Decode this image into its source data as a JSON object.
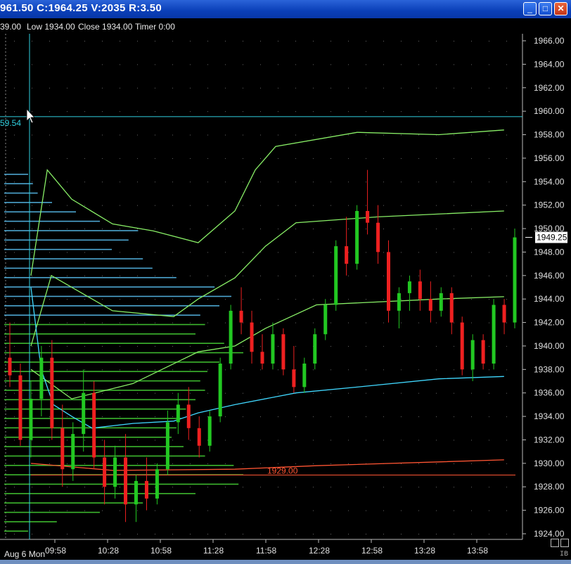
{
  "window": {
    "title": "961.50 C:1964.25 V:2035 R:3.50",
    "minimize_label": "_",
    "maximize_label": "□",
    "close_label": "✕"
  },
  "infobar": {
    "high": "39.00",
    "low": "Low 1934.00",
    "close": "Close 1934.00",
    "timer": "Timer 0:00"
  },
  "colors": {
    "up_candle": "#22c822",
    "down_candle": "#ee2020",
    "vwap": "#88ee66",
    "band_upper": "#88ee66",
    "band_lower": "#40d8ff",
    "profile_upper": "#55b8e8",
    "profile_lower": "#44cc33",
    "level_line": "#ff5533",
    "crosshair": "#30d0e0"
  },
  "chart_data": {
    "type": "candlestick",
    "y_ticks": [
      "1966.00",
      "1964.00",
      "1962.00",
      "1960.00",
      "1958.00",
      "1956.00",
      "1954.00",
      "1952.00",
      "1950.00",
      "1948.00",
      "1946.00",
      "1944.00",
      "1942.00",
      "1940.00",
      "1938.00",
      "1936.00",
      "1934.00",
      "1932.00",
      "1930.00",
      "1928.00",
      "1926.00",
      "1924.00"
    ],
    "x_ticks": [
      "09:58",
      "10:28",
      "10:58",
      "11:28",
      "11:58",
      "12:28",
      "12:58",
      "13:28",
      "13:58"
    ],
    "ylim": [
      1924,
      1966
    ],
    "date_label": "Aug 6 Mon",
    "source_label": "IB",
    "last_price": "1949.25",
    "crosshair_price": "59.54",
    "crosshair_price_value": 1959.54,
    "level_price": "1929.00",
    "level_value": 1929.0,
    "vwap_segment": [
      {
        "t": 0,
        "p": 1945.0
      },
      {
        "t": 5,
        "p": 1938.0
      },
      {
        "t": 11,
        "p": 1935.0
      },
      {
        "t": 20,
        "p": 1934.0
      },
      {
        "t": 30,
        "p": 1933.0
      },
      {
        "t": 50,
        "p": 1933.4
      },
      {
        "t": 70,
        "p": 1933.6
      },
      {
        "t": 82,
        "p": 1934.3
      },
      {
        "t": 100,
        "p": 1935.0
      },
      {
        "t": 130,
        "p": 1936.0
      },
      {
        "t": 160,
        "p": 1936.5
      },
      {
        "t": 200,
        "p": 1937.2
      },
      {
        "t": 232,
        "p": 1937.4
      }
    ],
    "upper_band": [
      {
        "t": 0,
        "p": 1946.0
      },
      {
        "t": 8,
        "p": 1955.0
      },
      {
        "t": 20,
        "p": 1952.5
      },
      {
        "t": 40,
        "p": 1950.4
      },
      {
        "t": 60,
        "p": 1949.8
      },
      {
        "t": 82,
        "p": 1948.8
      },
      {
        "t": 100,
        "p": 1951.5
      },
      {
        "t": 110,
        "p": 1955.0
      },
      {
        "t": 120,
        "p": 1957.0
      },
      {
        "t": 160,
        "p": 1958.2
      },
      {
        "t": 200,
        "p": 1958.0
      },
      {
        "t": 232,
        "p": 1958.4
      }
    ],
    "mid_band": [
      {
        "t": 0,
        "p": 1940.0
      },
      {
        "t": 10,
        "p": 1946.0
      },
      {
        "t": 40,
        "p": 1943.0
      },
      {
        "t": 70,
        "p": 1942.5
      },
      {
        "t": 82,
        "p": 1944.0
      },
      {
        "t": 100,
        "p": 1945.8
      },
      {
        "t": 115,
        "p": 1948.5
      },
      {
        "t": 130,
        "p": 1950.5
      },
      {
        "t": 170,
        "p": 1951.0
      },
      {
        "t": 232,
        "p": 1951.5
      }
    ],
    "lower_band": [
      {
        "t": 0,
        "p": 1938.0
      },
      {
        "t": 20,
        "p": 1935.5
      },
      {
        "t": 50,
        "p": 1936.8
      },
      {
        "t": 82,
        "p": 1939.5
      },
      {
        "t": 100,
        "p": 1940.0
      },
      {
        "t": 115,
        "p": 1941.5
      },
      {
        "t": 140,
        "p": 1943.5
      },
      {
        "t": 200,
        "p": 1944.0
      },
      {
        "t": 232,
        "p": 1944.2
      }
    ],
    "red_curve": [
      {
        "t": 0,
        "p": 1930.0
      },
      {
        "t": 40,
        "p": 1929.4
      },
      {
        "t": 100,
        "p": 1929.5
      },
      {
        "t": 140,
        "p": 1929.8
      },
      {
        "t": 232,
        "p": 1930.3
      }
    ],
    "candles": [
      {
        "o": 1939.0,
        "h": 1942.0,
        "l": 1936.5,
        "c": 1937.5
      },
      {
        "o": 1937.5,
        "h": 1938.5,
        "l": 1931.5,
        "c": 1932.0
      },
      {
        "o": 1932.0,
        "h": 1937.0,
        "l": 1930.5,
        "c": 1935.5
      },
      {
        "o": 1935.5,
        "h": 1940.0,
        "l": 1934.0,
        "c": 1939.0
      },
      {
        "o": 1939.0,
        "h": 1940.5,
        "l": 1932.0,
        "c": 1933.0
      },
      {
        "o": 1933.0,
        "h": 1935.0,
        "l": 1928.0,
        "c": 1929.5
      },
      {
        "o": 1929.5,
        "h": 1933.5,
        "l": 1928.5,
        "c": 1932.5
      },
      {
        "o": 1932.5,
        "h": 1938.0,
        "l": 1931.0,
        "c": 1936.0
      },
      {
        "o": 1936.0,
        "h": 1937.0,
        "l": 1929.5,
        "c": 1930.5
      },
      {
        "o": 1930.5,
        "h": 1932.0,
        "l": 1926.5,
        "c": 1928.0
      },
      {
        "o": 1928.0,
        "h": 1931.5,
        "l": 1927.0,
        "c": 1930.5
      },
      {
        "o": 1930.5,
        "h": 1932.5,
        "l": 1925.0,
        "c": 1926.5
      },
      {
        "o": 1926.5,
        "h": 1929.0,
        "l": 1925.0,
        "c": 1928.5
      },
      {
        "o": 1928.5,
        "h": 1930.5,
        "l": 1926.0,
        "c": 1927.0
      },
      {
        "o": 1927.0,
        "h": 1930.0,
        "l": 1926.5,
        "c": 1929.5
      },
      {
        "o": 1929.5,
        "h": 1934.5,
        "l": 1929.0,
        "c": 1933.5
      },
      {
        "o": 1933.5,
        "h": 1936.0,
        "l": 1932.5,
        "c": 1935.0
      },
      {
        "o": 1935.0,
        "h": 1936.5,
        "l": 1932.0,
        "c": 1933.0
      },
      {
        "o": 1933.0,
        "h": 1934.0,
        "l": 1930.5,
        "c": 1931.5
      },
      {
        "o": 1931.5,
        "h": 1934.5,
        "l": 1931.0,
        "c": 1934.0
      },
      {
        "o": 1934.0,
        "h": 1939.0,
        "l": 1933.5,
        "c": 1938.5
      },
      {
        "o": 1938.5,
        "h": 1943.5,
        "l": 1938.0,
        "c": 1943.0
      },
      {
        "o": 1943.0,
        "h": 1945.0,
        "l": 1941.0,
        "c": 1942.0
      },
      {
        "o": 1942.0,
        "h": 1943.0,
        "l": 1938.5,
        "c": 1939.5
      },
      {
        "o": 1939.5,
        "h": 1941.0,
        "l": 1938.0,
        "c": 1938.5
      },
      {
        "o": 1938.5,
        "h": 1942.0,
        "l": 1938.0,
        "c": 1941.0
      },
      {
        "o": 1941.0,
        "h": 1941.5,
        "l": 1937.5,
        "c": 1938.0
      },
      {
        "o": 1938.0,
        "h": 1940.0,
        "l": 1936.0,
        "c": 1936.5
      },
      {
        "o": 1936.5,
        "h": 1939.0,
        "l": 1936.0,
        "c": 1938.5
      },
      {
        "o": 1938.5,
        "h": 1941.5,
        "l": 1938.0,
        "c": 1941.0
      },
      {
        "o": 1941.0,
        "h": 1944.0,
        "l": 1940.5,
        "c": 1943.5
      },
      {
        "o": 1943.5,
        "h": 1949.0,
        "l": 1943.0,
        "c": 1948.5
      },
      {
        "o": 1948.5,
        "h": 1951.0,
        "l": 1946.0,
        "c": 1947.0
      },
      {
        "o": 1947.0,
        "h": 1952.0,
        "l": 1946.5,
        "c": 1951.5
      },
      {
        "o": 1951.5,
        "h": 1955.0,
        "l": 1949.5,
        "c": 1950.5
      },
      {
        "o": 1950.5,
        "h": 1952.0,
        "l": 1947.0,
        "c": 1948.0
      },
      {
        "o": 1948.0,
        "h": 1949.0,
        "l": 1942.0,
        "c": 1943.0
      },
      {
        "o": 1943.0,
        "h": 1945.0,
        "l": 1941.5,
        "c": 1944.5
      },
      {
        "o": 1944.5,
        "h": 1946.0,
        "l": 1943.0,
        "c": 1945.5
      },
      {
        "o": 1945.5,
        "h": 1946.5,
        "l": 1943.0,
        "c": 1944.0
      },
      {
        "o": 1944.0,
        "h": 1945.5,
        "l": 1942.0,
        "c": 1943.0
      },
      {
        "o": 1943.0,
        "h": 1945.0,
        "l": 1942.5,
        "c": 1944.5
      },
      {
        "o": 1944.5,
        "h": 1945.0,
        "l": 1941.0,
        "c": 1942.0
      },
      {
        "o": 1942.0,
        "h": 1942.5,
        "l": 1937.5,
        "c": 1938.0
      },
      {
        "o": 1938.0,
        "h": 1941.0,
        "l": 1937.0,
        "c": 1940.5
      },
      {
        "o": 1940.5,
        "h": 1941.0,
        "l": 1938.0,
        "c": 1938.5
      },
      {
        "o": 1938.5,
        "h": 1944.0,
        "l": 1938.0,
        "c": 1943.5
      },
      {
        "o": 1943.5,
        "h": 1944.0,
        "l": 1941.0,
        "c": 1942.0
      },
      {
        "o": 1942.0,
        "h": 1950.0,
        "l": 1941.5,
        "c": 1949.25
      }
    ],
    "volume_profile": [
      {
        "p": 1954.6,
        "w": 0.1
      },
      {
        "p": 1953.8,
        "w": 0.12
      },
      {
        "p": 1953.0,
        "w": 0.14
      },
      {
        "p": 1952.2,
        "w": 0.2
      },
      {
        "p": 1951.4,
        "w": 0.3
      },
      {
        "p": 1950.6,
        "w": 0.4
      },
      {
        "p": 1949.8,
        "w": 0.56
      },
      {
        "p": 1949.0,
        "w": 0.52
      },
      {
        "p": 1948.2,
        "w": 0.45
      },
      {
        "p": 1947.4,
        "w": 0.58
      },
      {
        "p": 1946.6,
        "w": 0.62
      },
      {
        "p": 1945.8,
        "w": 0.72
      },
      {
        "p": 1945.0,
        "w": 0.88
      },
      {
        "p": 1944.2,
        "w": 0.95
      },
      {
        "p": 1943.4,
        "w": 0.9
      },
      {
        "p": 1942.6,
        "w": 0.82
      },
      {
        "p": 1941.8,
        "w": 0.84
      },
      {
        "p": 1941.0,
        "w": 0.8
      },
      {
        "p": 1940.2,
        "w": 0.92
      },
      {
        "p": 1939.4,
        "w": 1.0
      },
      {
        "p": 1938.6,
        "w": 0.9
      },
      {
        "p": 1937.8,
        "w": 0.85
      },
      {
        "p": 1937.0,
        "w": 0.82
      },
      {
        "p": 1936.2,
        "w": 0.84
      },
      {
        "p": 1935.4,
        "w": 0.8
      },
      {
        "p": 1934.6,
        "w": 0.76
      },
      {
        "p": 1933.8,
        "w": 0.74
      },
      {
        "p": 1933.0,
        "w": 0.72
      },
      {
        "p": 1932.2,
        "w": 0.7
      },
      {
        "p": 1931.4,
        "w": 0.75
      },
      {
        "p": 1930.6,
        "w": 0.84
      },
      {
        "p": 1929.8,
        "w": 0.96
      },
      {
        "p": 1929.0,
        "w": 1.0
      },
      {
        "p": 1928.2,
        "w": 0.98
      },
      {
        "p": 1927.4,
        "w": 0.8
      },
      {
        "p": 1926.6,
        "w": 0.58
      },
      {
        "p": 1925.8,
        "w": 0.4
      },
      {
        "p": 1925.0,
        "w": 0.22
      },
      {
        "p": 1924.2,
        "w": 0.1
      }
    ]
  }
}
